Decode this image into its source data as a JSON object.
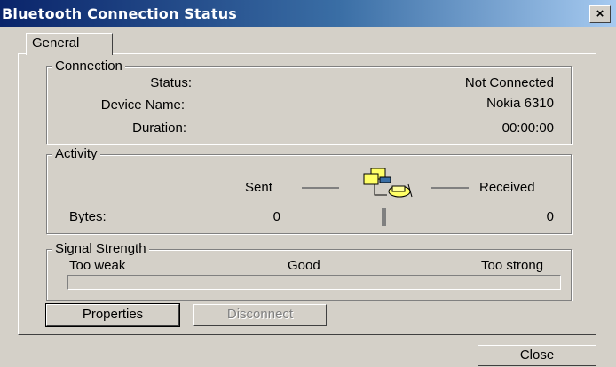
{
  "window": {
    "title": "Bluetooth Connection Status",
    "close_glyph": "×"
  },
  "tabs": [
    {
      "label": "General",
      "selected": true
    }
  ],
  "connection": {
    "legend": "Connection",
    "status_label": "Status:",
    "status_value": "Not Connected",
    "device_label": "Device Name:",
    "device_value": "Nokia 6310",
    "duration_label": "Duration:",
    "duration_value": "00:00:00"
  },
  "activity": {
    "legend": "Activity",
    "sent_label": "Sent",
    "received_label": "Received",
    "bytes_label": "Bytes:",
    "bytes_sent": "0",
    "bytes_received": "0",
    "icon": "network-computers-icon"
  },
  "signal": {
    "legend": "Signal Strength",
    "low_label": "Too weak",
    "mid_label": "Good",
    "high_label": "Too strong",
    "level": 0
  },
  "buttons": {
    "properties": "Properties",
    "disconnect": "Disconnect",
    "close": "Close"
  },
  "colors": {
    "titlebar_start": "#0a246a",
    "face": "#d4d0c8"
  }
}
